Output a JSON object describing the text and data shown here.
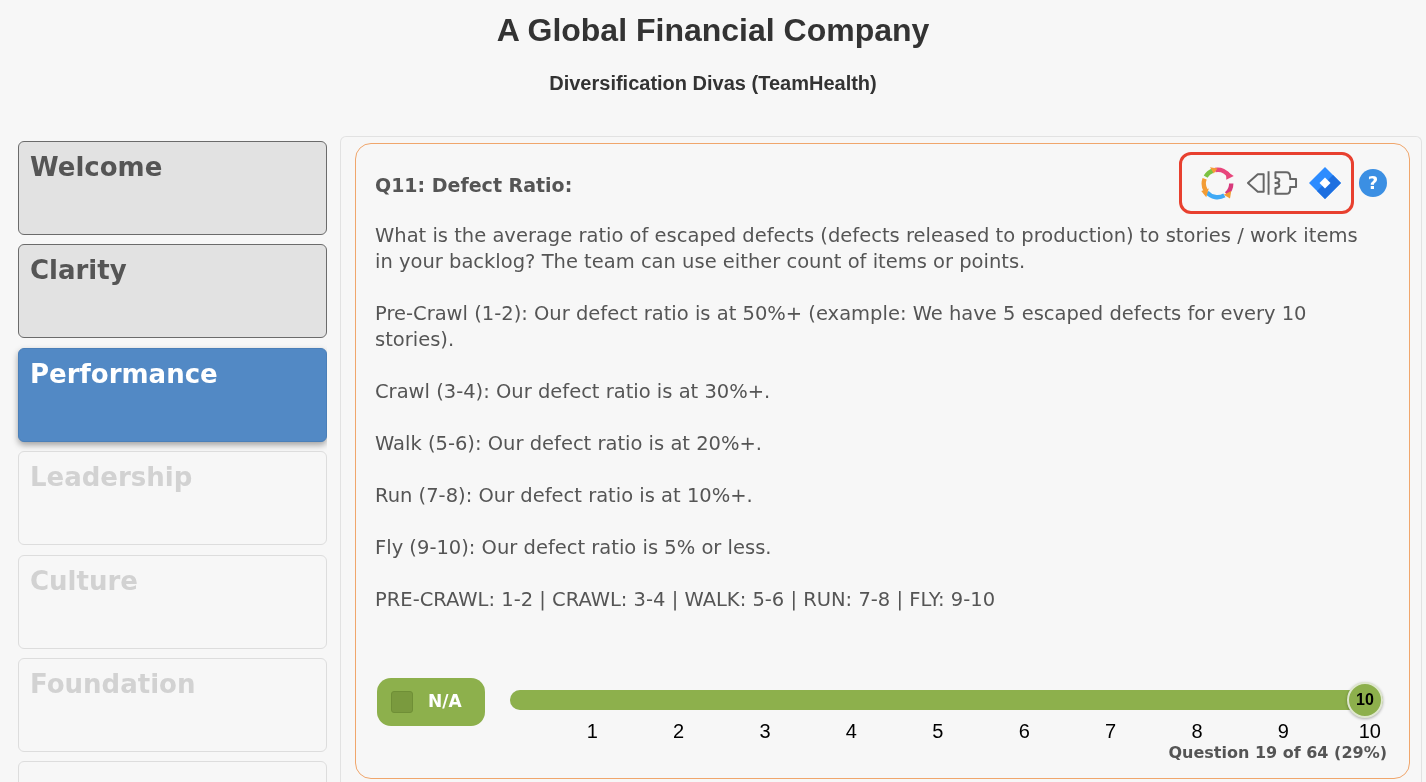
{
  "header": {
    "title": "A Global Financial Company",
    "subtitle": "Diversification Divas (TeamHealth)"
  },
  "sidebar": {
    "items": [
      {
        "label": "Welcome",
        "selected": false,
        "disabled": false
      },
      {
        "label": "Clarity",
        "selected": false,
        "disabled": false
      },
      {
        "label": "Performance",
        "selected": true,
        "disabled": false
      },
      {
        "label": "Leadership",
        "selected": false,
        "disabled": true
      },
      {
        "label": "Culture",
        "selected": false,
        "disabled": true
      },
      {
        "label": "Foundation",
        "selected": false,
        "disabled": true
      },
      {
        "selected": false,
        "disabled": true
      }
    ]
  },
  "question": {
    "title": "Q11: Defect Ratio:",
    "help": "?",
    "paragraphs": [
      "What is the average ratio of escaped defects (defects released to production) to stories / work items in your backlog? The team can use either count of items or points.",
      "Pre-Crawl (1-2): Our defect ratio is at 50%+ (example: We have 5 escaped defects for every 10 stories).",
      "Crawl (3-4): Our defect ratio is at 30%+.",
      "Walk (5-6): Our defect ratio is at 20%+.",
      "Run (7-8): Our defect ratio is at 10%+.",
      "Fly (9-10): Our defect ratio is 5% or less.",
      "PRE-CRAWL: 1-2 | CRAWL: 3-4 | WALK: 5-6 | RUN: 7-8 | FLY: 9-10"
    ]
  },
  "answer": {
    "na": {
      "label": "N/A",
      "checked": false
    },
    "slider": {
      "level": 1,
      "value_label": "10",
      "ticks": [
        "1",
        "2",
        "3",
        "4",
        "5",
        "6",
        "7",
        "8",
        "9",
        "10"
      ]
    }
  },
  "progress": "Question 19 of 64 (29%)"
}
